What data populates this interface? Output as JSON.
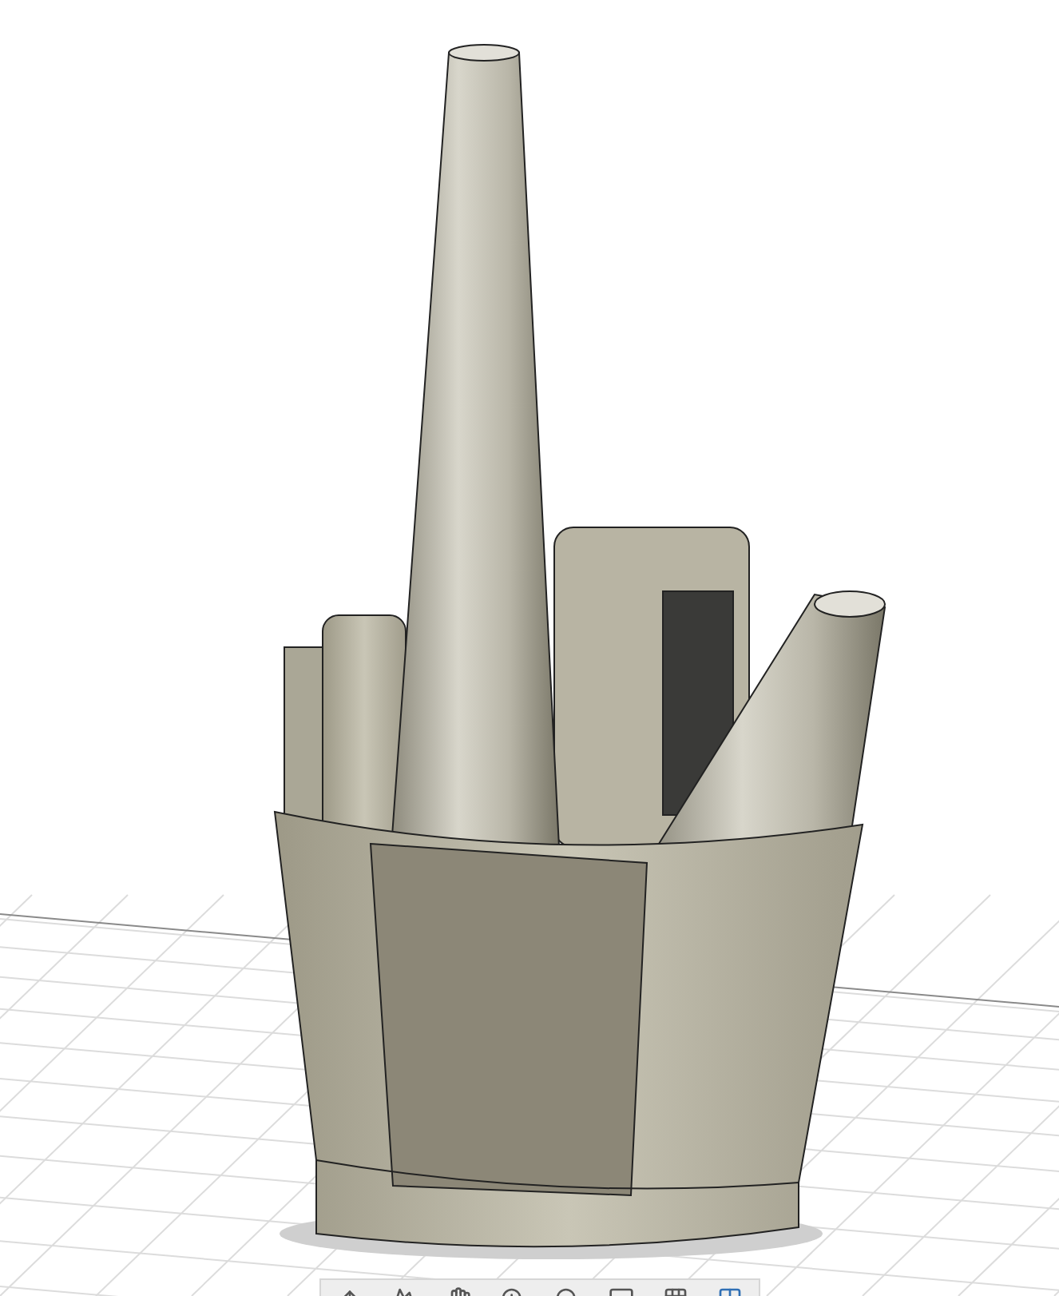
{
  "viewport": {
    "grid_visible": true
  },
  "navigation_toolbar": {
    "tools": [
      {
        "kind": "orbit"
      },
      {
        "kind": "look"
      },
      {
        "kind": "pan"
      },
      {
        "kind": "zoom"
      },
      {
        "kind": "fit"
      },
      {
        "kind": "display"
      },
      {
        "kind": "grid"
      },
      {
        "kind": "viewports"
      }
    ]
  }
}
